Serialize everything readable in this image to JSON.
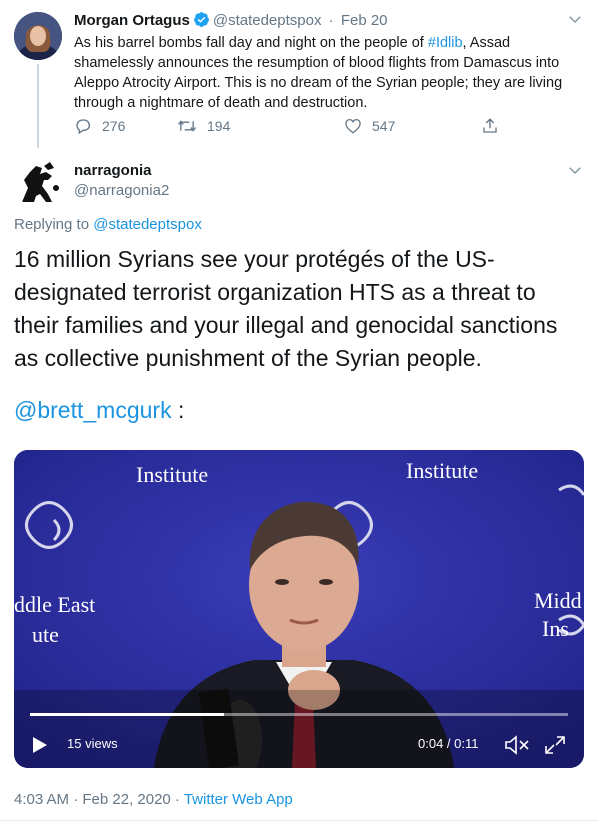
{
  "parent_tweet": {
    "author_name": "Morgan Ortagus",
    "handle": "@statedeptspox",
    "date": "Feb 20",
    "text_before": "As his barrel bombs fall day and night on the people of ",
    "hashtag": "#Idlib",
    "text_after": ", Assad shamelessly announces the resumption of blood flights from Damascus into Aleppo Atrocity Airport. This is no dream of the Syrian people; they are living through a nightmare of death and destruction.",
    "reply_count": "276",
    "retweet_count": "194",
    "like_count": "547"
  },
  "reply_tweet": {
    "author_name": "narragonia",
    "handle": "@narragonia2",
    "replying_label": "Replying to",
    "replying_to": "@statedeptspox",
    "text": "16 million Syrians see your protégés of the US-designated terrorist organization HTS as a threat to their families and your illegal and genocidal sanctions as collective punishment of the Syrian people.",
    "mention": "@brett_mcgurk",
    "mention_suffix": " :",
    "timestamp": "4:03 AM · Feb 22, 2020 · ",
    "source": "Twitter Web App"
  },
  "video": {
    "views": "15 views",
    "time": "0:04 / 0:11",
    "progress_fraction": 0.36,
    "backdrop_text": {
      "institute_left": "Institute",
      "institute_right": "Institute",
      "middle_east_left": "ddle East",
      "ute_left": "ute",
      "midd_right": "Midd",
      "ins_right": "Ins"
    }
  },
  "colors": {
    "link": "#1b95e0",
    "muted": "#657786",
    "verified": "#1da1f2",
    "video_backdrop": "#2c2e9c"
  },
  "icons": [
    "chevron-down-icon",
    "verified-badge-icon",
    "reply-icon",
    "retweet-icon",
    "like-icon",
    "share-icon",
    "play-icon",
    "mute-icon",
    "fullscreen-icon"
  ]
}
